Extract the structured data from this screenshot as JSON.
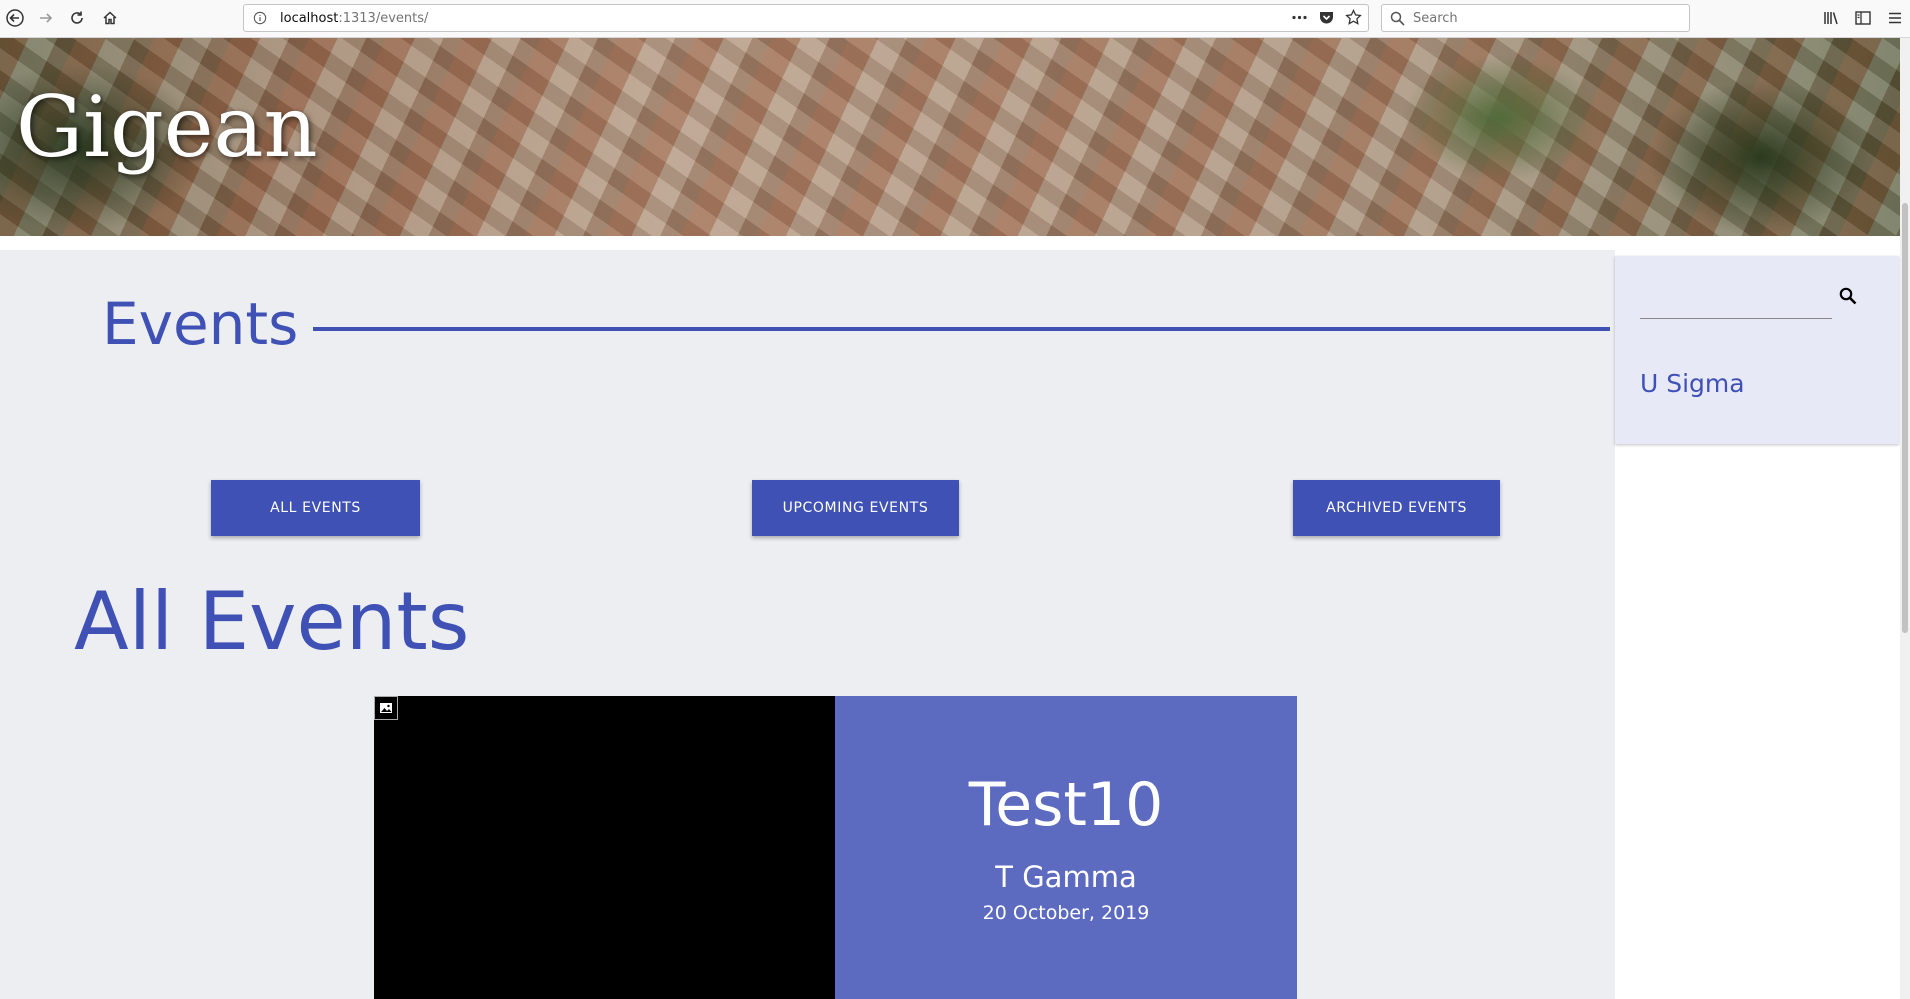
{
  "browser": {
    "url_host": "localhost",
    "url_path": ":1313/events/",
    "search_placeholder": "Search"
  },
  "site": {
    "title": "Gigean"
  },
  "page": {
    "heading": "Events",
    "tabs": [
      {
        "label": "ALL EVENTS"
      },
      {
        "label": "UPCOMING EVENTS"
      },
      {
        "label": "ARCHIVED EVENTS"
      }
    ],
    "section_heading": "All Events"
  },
  "events": [
    {
      "title": "Test10",
      "organizer": "T Gamma",
      "date": "20 October, 2019"
    }
  ],
  "sidebar": {
    "link_label": "U Sigma"
  },
  "colors": {
    "accent": "#3f51b5",
    "card": "#5c6bc0",
    "background": "#eceef2"
  }
}
